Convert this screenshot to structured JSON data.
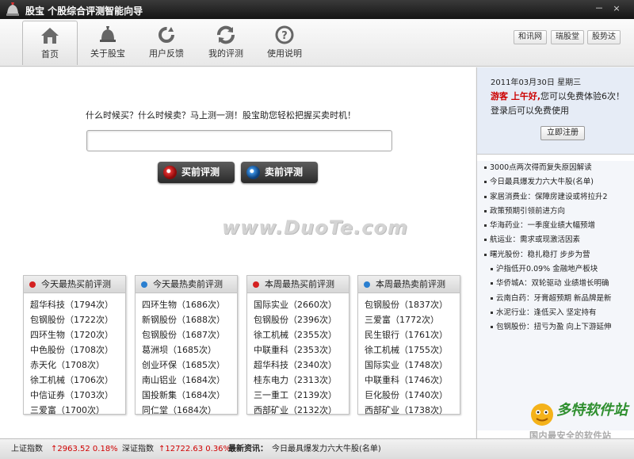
{
  "window": {
    "title": "股宝 个股综合评测智能向导",
    "buttons": [
      "－",
      "×"
    ]
  },
  "toolbar": {
    "items": [
      {
        "label": "首页",
        "icon": "home-icon"
      },
      {
        "label": "关于股宝",
        "icon": "helmet-icon"
      },
      {
        "label": "用户反馈",
        "icon": "refresh-icon"
      },
      {
        "label": "我的评测",
        "icon": "cycle-icon"
      },
      {
        "label": "使用说明",
        "icon": "help-icon"
      }
    ],
    "links": [
      "和讯网",
      "瑞股堂",
      "股势达"
    ]
  },
  "main": {
    "prompt": "什么时候买？什么时候卖？马上测一测！股宝助您轻松把握买卖时机！",
    "search_value": "",
    "buy_button": "买前评测",
    "sell_button": "卖前评测",
    "watermark": "www.DuoTe.com"
  },
  "panels": [
    {
      "title": "今天最热买前评测",
      "bullet_color": "#d42020",
      "items": [
        "超华科技（1794次）",
        "包钢股份（1722次）",
        "四环生物（1720次）",
        "中色股份（1708次）",
        "赤天化（1708次）",
        "徐工机械（1706次）",
        "中信证券（1703次）",
        "三爱富（1700次）"
      ]
    },
    {
      "title": "今天最热卖前评测",
      "bullet_color": "#2a7fd0",
      "items": [
        "四环生物（1686次）",
        "新钢股份（1688次）",
        "包钢股份（1687次）",
        "葛洲坝（1685次）",
        "创业环保（1685次）",
        "南山铝业（1684次）",
        "国投新集（1684次）",
        "同仁堂（1684次）"
      ]
    },
    {
      "title": "本周最热买前评测",
      "bullet_color": "#d42020",
      "items": [
        "国际实业（2660次）",
        "包钢股份（2396次）",
        "徐工机械（2355次）",
        "中联重科（2353次）",
        "超华科技（2340次）",
        "桂东电力（2313次）",
        "三一重工（2139次）",
        "西部矿业（2132次）"
      ]
    },
    {
      "title": "本周最热卖前评测",
      "bullet_color": "#2a7fd0",
      "items": [
        "包钢股份（1837次）",
        "三爱富（1772次）",
        "民生银行（1761次）",
        "徐工机械（1755次）",
        "国际实业（1748次）",
        "中联重科（1746次）",
        "巨化股份（1740次）",
        "西部矿业（1738次）"
      ]
    }
  ],
  "sidebar": {
    "date": "2011年03月30日  星期三",
    "greeting_bold": "游客 上午好,",
    "greeting_text": "您可以免费体验6次！登录后可以免费使用",
    "register_button": "立即注册",
    "news": [
      "3000点两次得而复失原因解读",
      "今日最具爆发力六大牛股(名单)",
      "家居消费业：保障房建设或将拉升2",
      "政策预期引领前进方向",
      "华海药业：一季度业绩大幅预增",
      "航运业：需求或现激活因素",
      "曙光股份：稳扎稳打 步步为营",
      "沪指低开0.09% 金融地产板块",
      "华侨城A：双轮驱动 业绩增长明确",
      "云南白药：牙膏超预期 新品牌是新",
      "水泥行业：逢低买入 坚定持有",
      "包钢股份：扭亏为盈 向上下游延伸"
    ]
  },
  "status": {
    "sh_label": "上证指数",
    "sh_value": "↑2963.52 0.18%",
    "sz_label": "深证指数",
    "sz_value": "↑12722.63 0.36%",
    "news_label": "最新资讯：",
    "news_text": "今日最具爆发力六大牛股(名单)"
  },
  "corner_logo": {
    "title": "多特软件站",
    "sub": "国内最安全的软件站"
  }
}
